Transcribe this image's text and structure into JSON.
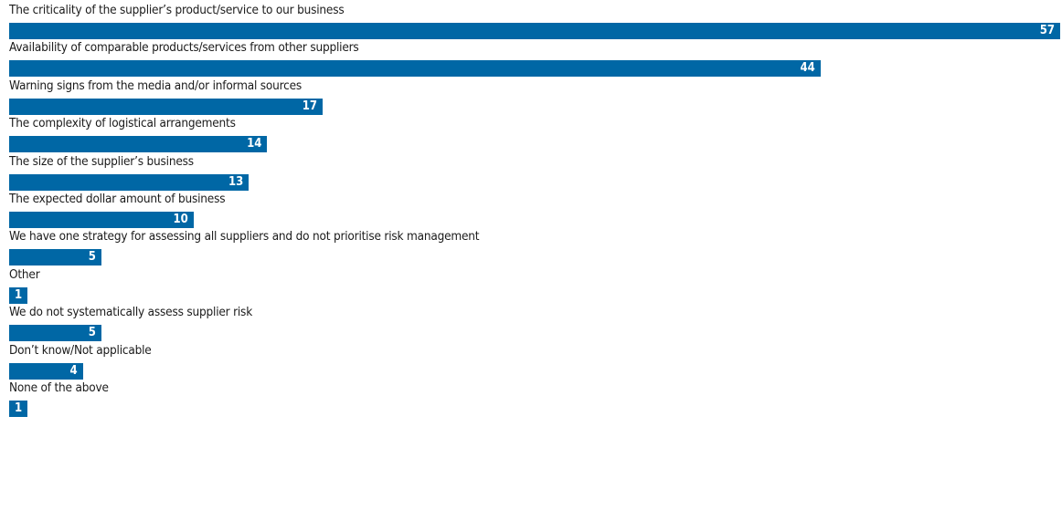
{
  "chart_data": {
    "type": "bar",
    "orientation": "horizontal",
    "categories": [
      "The criticality of the supplier’s product/service to our business",
      "Availability of comparable products/services from other suppliers",
      "Warning signs from the media and/or informal sources",
      "The complexity of logistical arrangements",
      "The size of the supplier’s business",
      "The expected dollar amount of business",
      "We have one strategy for assessing all suppliers and do not prioritise risk management",
      "Other",
      "We do not systematically assess supplier risk",
      "Don’t know/Not applicable",
      "None of the above"
    ],
    "values": [
      57,
      44,
      17,
      14,
      13,
      10,
      5,
      1,
      5,
      4,
      1
    ],
    "title": "",
    "xlabel": "",
    "ylabel": "",
    "xlim": [
      0,
      57
    ],
    "grid": false,
    "bar_color": "#0067a5",
    "value_label_color": "#ffffff"
  }
}
